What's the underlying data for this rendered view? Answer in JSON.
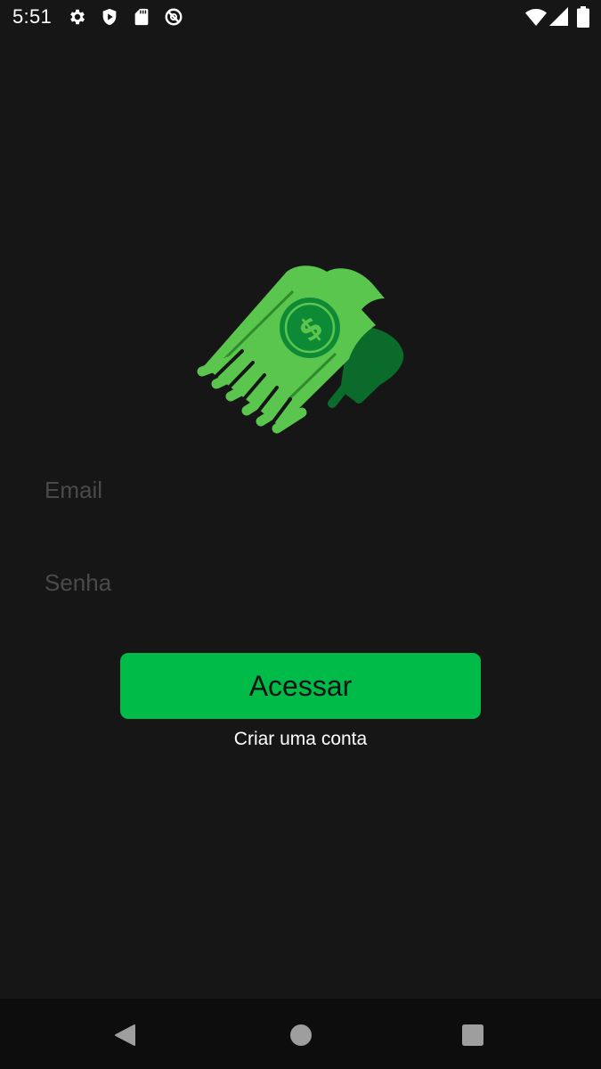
{
  "status_bar": {
    "time": "5:51",
    "left_icons": [
      "settings-icon",
      "play-protect-icon",
      "sd-card-icon",
      "data-saver-icon"
    ],
    "right_icons": [
      "wifi-icon",
      "signal-icon",
      "battery-icon"
    ]
  },
  "logo": {
    "icon": "flying-money-icon",
    "symbol": "$",
    "colors": {
      "light_green": "#5bc64d",
      "dark_green": "#0b7a2e",
      "coin": "#0e8a36"
    }
  },
  "form": {
    "email_placeholder": "Email",
    "email_value": "",
    "password_placeholder": "Senha",
    "password_value": ""
  },
  "actions": {
    "login_label": "Acessar",
    "signup_label": "Criar uma conta"
  },
  "nav_bar": {
    "buttons": [
      "back-icon",
      "home-icon",
      "recents-icon"
    ]
  },
  "colors": {
    "background": "#161616",
    "accent": "#00bb48",
    "placeholder": "#4a4a4a",
    "nav_background": "#0d0d0d"
  }
}
